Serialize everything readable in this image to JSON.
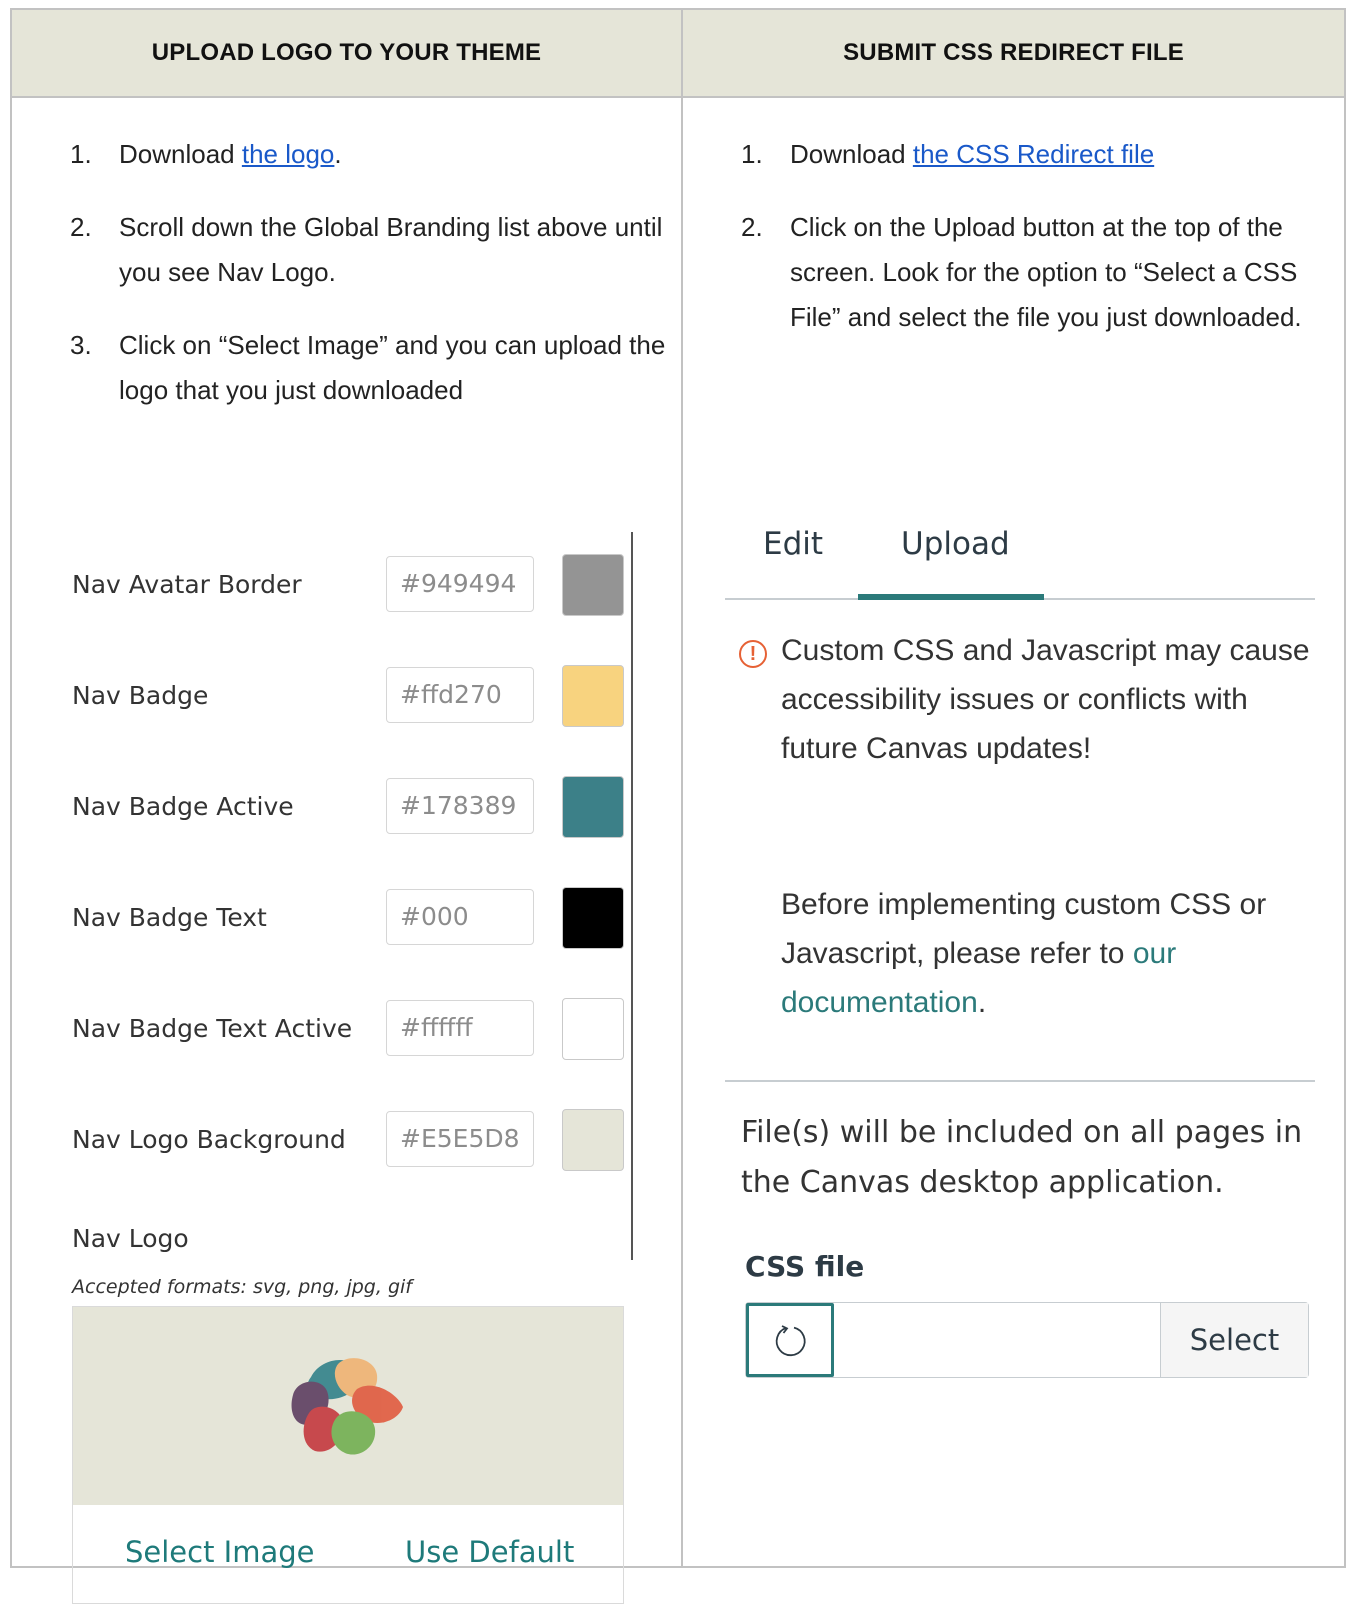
{
  "headers": {
    "left": "UPLOAD LOGO TO YOUR THEME",
    "right": "SUBMIT CSS REDIRECT FILE"
  },
  "left_steps": [
    {
      "num": "1.",
      "pre": "Download ",
      "link": "the logo",
      "post": "."
    },
    {
      "num": "2.",
      "text": "Scroll down the Global Branding list above until you see Nav Logo."
    },
    {
      "num": "3.",
      "text": "Click on “Select Image” and you can upload the logo that you just downloaded"
    }
  ],
  "right_steps": [
    {
      "num": "1.",
      "pre": "Download ",
      "link": "the CSS Redirect file"
    },
    {
      "num": "2.",
      "text": "Click on the Upload button at the top of the screen. Look for the option to “Select a CSS File” and select the file you just downloaded."
    }
  ],
  "branding": [
    {
      "label": "Nav Avatar Border",
      "hex": "#949494",
      "color": "#949494"
    },
    {
      "label": "Nav Badge",
      "hex": "#ffd270",
      "color": "#f8d37f"
    },
    {
      "label": "Nav Badge Active",
      "hex": "#178389",
      "color": "#3c8088"
    },
    {
      "label": "Nav Badge Text",
      "hex": "#000",
      "color": "#000000"
    },
    {
      "label": "Nav Badge Text Active",
      "hex": "#ffffff",
      "color": "#ffffff"
    },
    {
      "label": "Nav Logo Background",
      "hex": "#E5E5D8",
      "color": "#e5e5d8"
    }
  ],
  "nav_logo": {
    "label": "Nav Logo",
    "formats": "Accepted formats: svg, png, jpg, gif",
    "select_image": "Select Image",
    "use_default": "Use Default"
  },
  "upload_pane": {
    "tabs": [
      "Edit",
      "Upload"
    ],
    "active_tab": "Upload",
    "warning_icon": "!",
    "warning": "Custom CSS and Javascript may cause accessibility issues or conflicts with future Canvas updates!",
    "before_text": "Before implementing custom CSS or Javascript, please refer to ",
    "doc_link": "our documentation",
    "doc_suffix": ".",
    "file_note": "File(s) will be included on all pages in the Canvas desktop application.",
    "css_label": "CSS file",
    "select_button": "Select"
  },
  "colors": {
    "header_bg": "#e5e5d8",
    "link_blue": "#1a59c9",
    "teal": "#2b7a7a",
    "warning_orange": "#e66135"
  }
}
